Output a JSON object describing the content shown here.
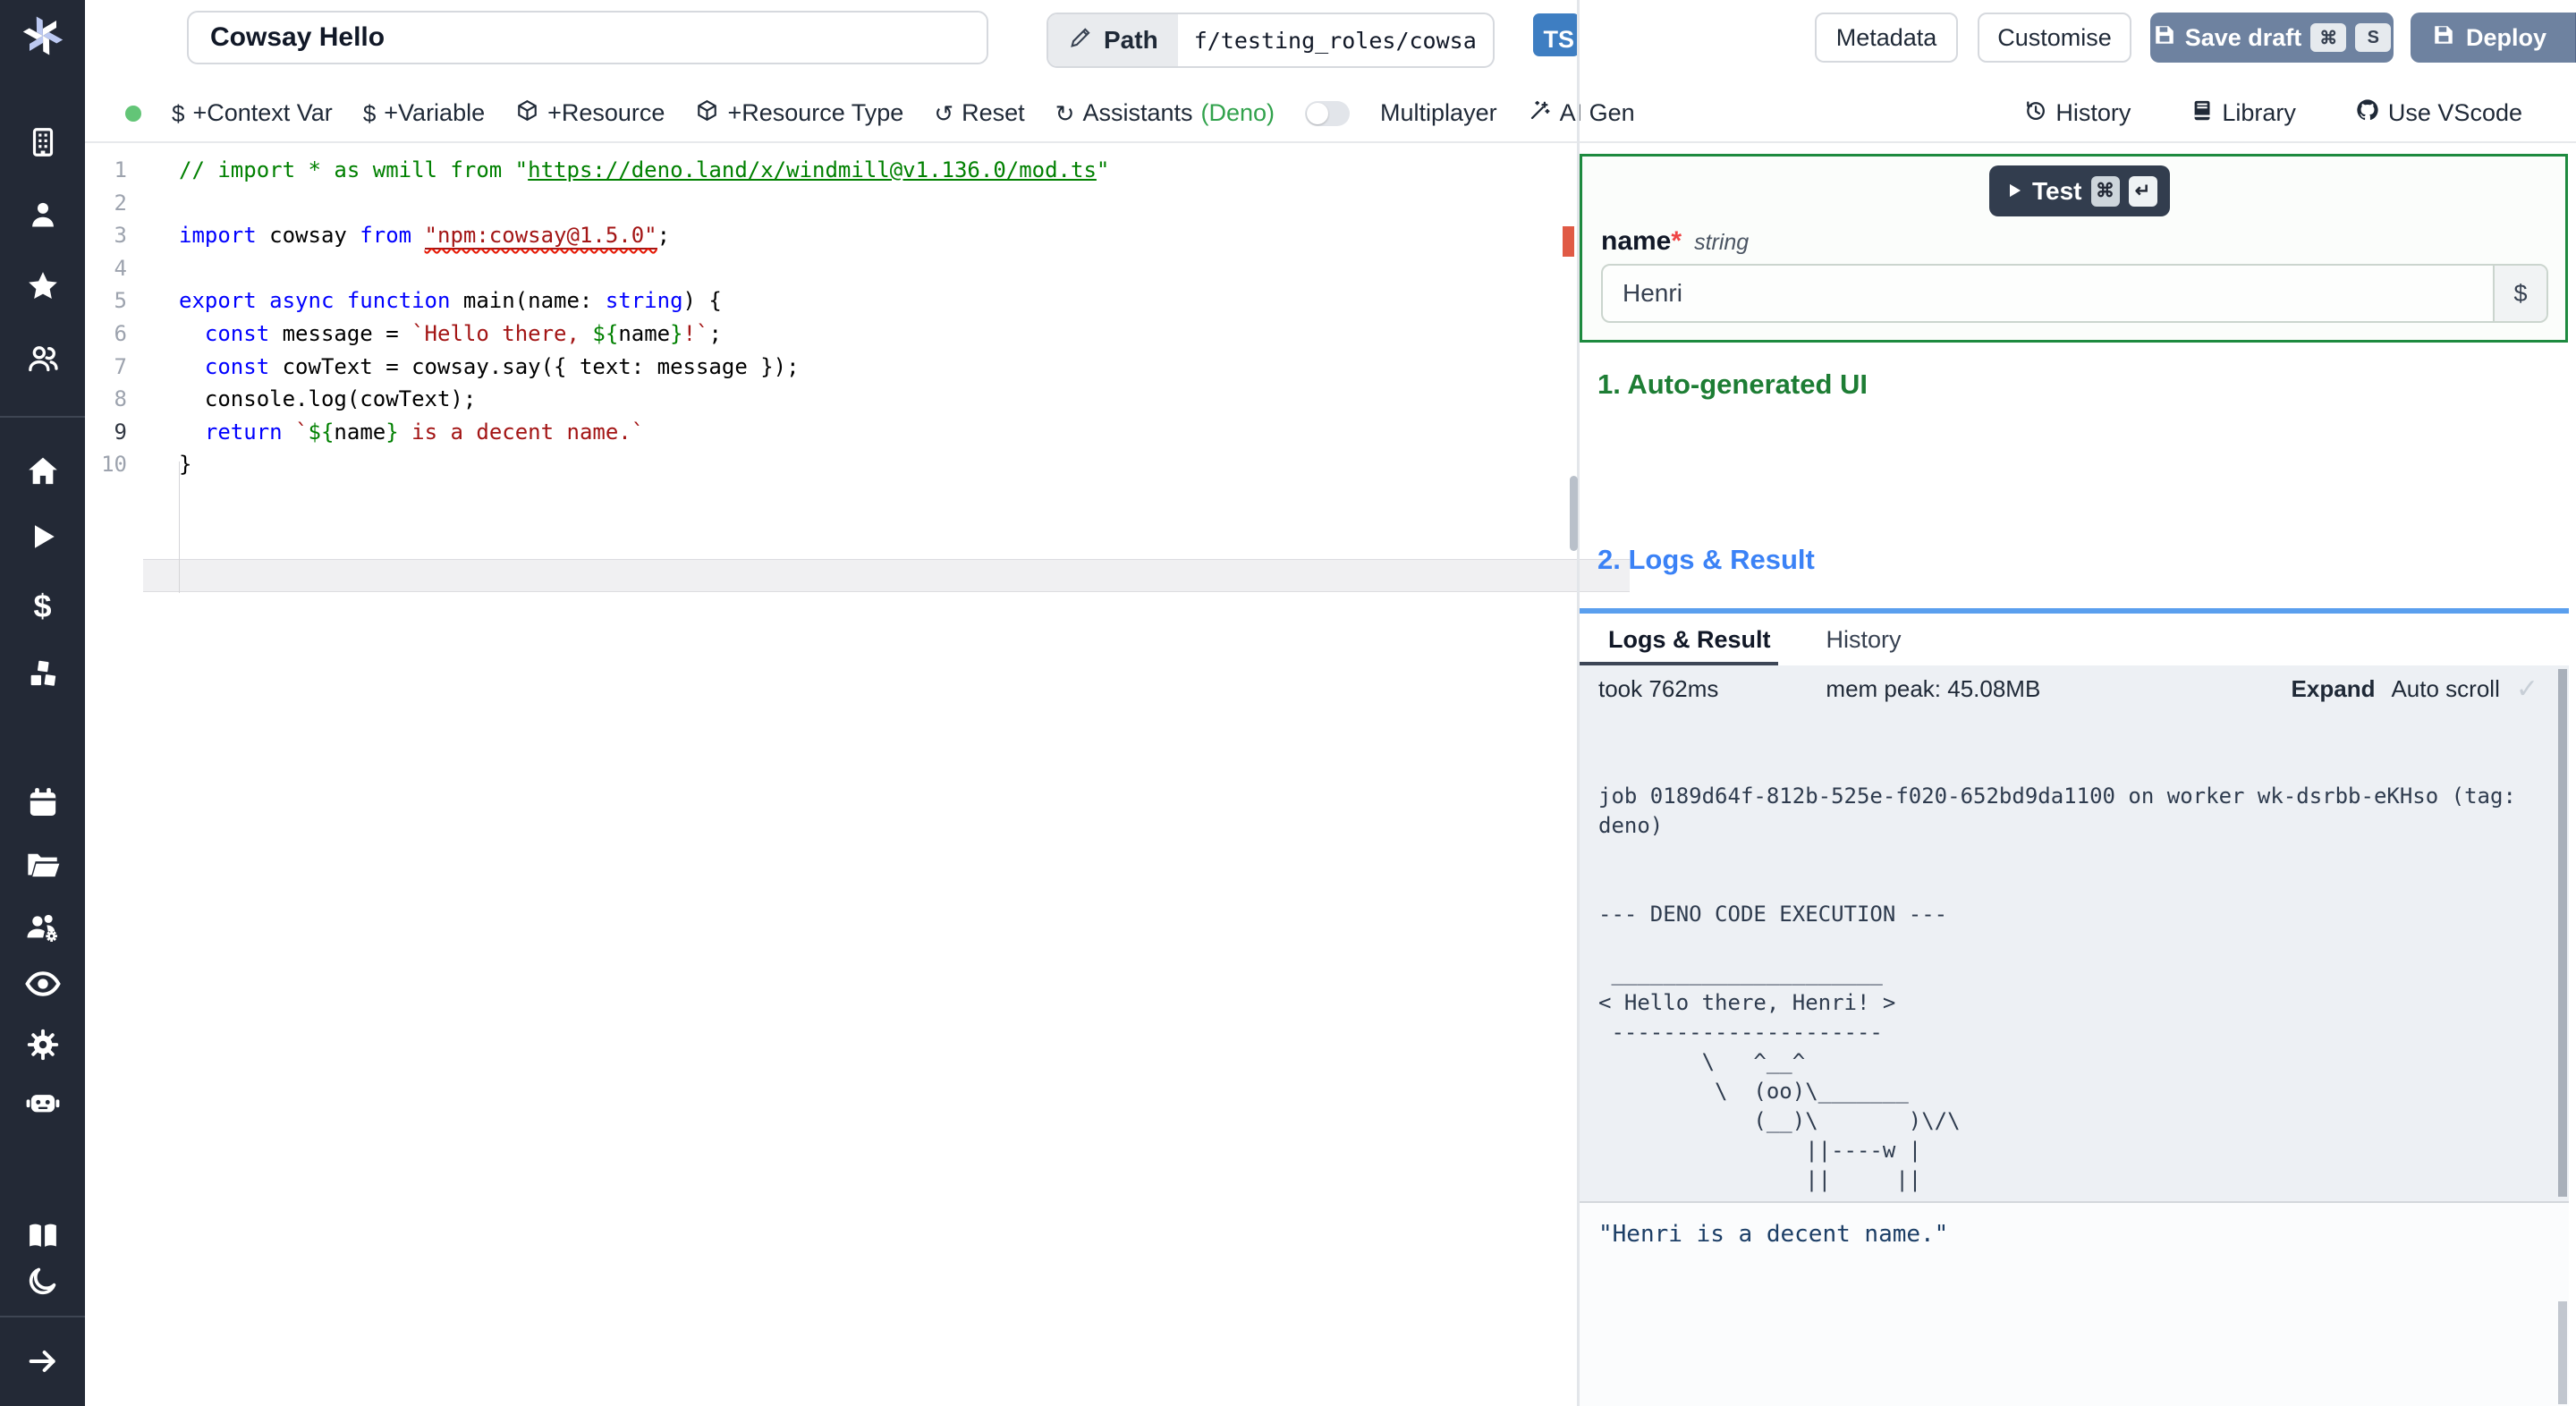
{
  "topbar": {
    "title_value": "Cowsay Hello",
    "path_label": "Path",
    "path_value": "f/testing_roles/cowsa",
    "lang_badge": "TS",
    "metadata_label": "Metadata",
    "customise_label": "Customise",
    "save_draft_label": "Save draft",
    "save_key_1": "⌘",
    "save_key_2": "S",
    "deploy_label": "Deploy"
  },
  "toolbar": {
    "context_var": "+Context Var",
    "variable": "+Variable",
    "resource": "+Resource",
    "resource_type": "+Resource Type",
    "reset": "Reset",
    "assistants": "Assistants",
    "assistants_lang": "(Deno)",
    "multiplayer": "Multiplayer",
    "ai_gen": "AI Gen",
    "history": "History",
    "library": "Library",
    "vscode": "Use VScode"
  },
  "editor": {
    "current_line": 9,
    "lines": [
      [
        {
          "c": "comment",
          "t": "// import * as wmill from \""
        },
        {
          "c": "comment-link",
          "t": "https://deno.land/x/windmill@v1.136.0/mod.ts"
        },
        {
          "c": "comment",
          "t": "\""
        }
      ],
      [],
      [
        {
          "c": "kw",
          "t": "import"
        },
        {
          "c": "plain",
          "t": " cowsay "
        },
        {
          "c": "kw",
          "t": "from"
        },
        {
          "c": "plain",
          "t": " "
        },
        {
          "c": "str-err",
          "t": "\"npm:cowsay@1.5.0\""
        },
        {
          "c": "plain",
          "t": ";"
        }
      ],
      [],
      [
        {
          "c": "kw",
          "t": "export async function"
        },
        {
          "c": "plain",
          "t": " main(name: "
        },
        {
          "c": "kw",
          "t": "string"
        },
        {
          "c": "plain",
          "t": ") {"
        }
      ],
      [
        {
          "c": "plain",
          "t": "  "
        },
        {
          "c": "kw",
          "t": "const"
        },
        {
          "c": "plain",
          "t": " message = "
        },
        {
          "c": "str",
          "t": "`Hello there, "
        },
        {
          "c": "expr",
          "t": "${"
        },
        {
          "c": "plain",
          "t": "name"
        },
        {
          "c": "expr",
          "t": "}"
        },
        {
          "c": "str",
          "t": "!`"
        },
        {
          "c": "plain",
          "t": ";"
        }
      ],
      [
        {
          "c": "plain",
          "t": "  "
        },
        {
          "c": "kw",
          "t": "const"
        },
        {
          "c": "plain",
          "t": " cowText = cowsay.say({ text: message });"
        }
      ],
      [
        {
          "c": "plain",
          "t": "  console.log(cowText);"
        }
      ],
      [
        {
          "c": "plain",
          "t": "  "
        },
        {
          "c": "kw",
          "t": "return"
        },
        {
          "c": "plain",
          "t": " "
        },
        {
          "c": "str",
          "t": "`"
        },
        {
          "c": "expr",
          "t": "${"
        },
        {
          "c": "plain",
          "t": "name"
        },
        {
          "c": "expr",
          "t": "}"
        },
        {
          "c": "str",
          "t": " is a decent name.`"
        }
      ],
      [
        {
          "c": "plain",
          "t": "}"
        }
      ]
    ]
  },
  "run_panel": {
    "test_label": "Test",
    "test_key_1": "⌘",
    "test_key_2": "↵",
    "field_name": "name",
    "field_required": "*",
    "field_type": "string",
    "field_value": "Henri",
    "var_button": "$",
    "section1": "1. Auto-generated UI",
    "section2": "2. Logs & Result",
    "tab_logs": "Logs & Result",
    "tab_history": "History",
    "stat_took": "took 762ms",
    "stat_mem": "mem peak: 45.08MB",
    "expand_label": "Expand",
    "autoscroll_label": "Auto scroll",
    "check_glyph": "✓",
    "log_lines": [
      "job 0189d64f-812b-525e-f020-652bd9da1100 on worker wk-dsrbb-eKHso (tag:",
      "deno)",
      "",
      "",
      "--- DENO CODE EXECUTION ---",
      "",
      " _____________________",
      "< Hello there, Henri! >",
      " ---------------------",
      "        \\   ^__^",
      "         \\  (oo)\\_______",
      "            (__)\\       )\\/\\",
      "                ||----w |",
      "                ||     ||"
    ],
    "result_value": "\"Henri is a decent name.\""
  },
  "colors": {
    "accent_green": "#1d8a3f",
    "heading_blue": "#3b82f6",
    "button_slate": "#6e82a0",
    "ts_blue": "#3e7ec2",
    "sidebar_bg": "#232936"
  }
}
